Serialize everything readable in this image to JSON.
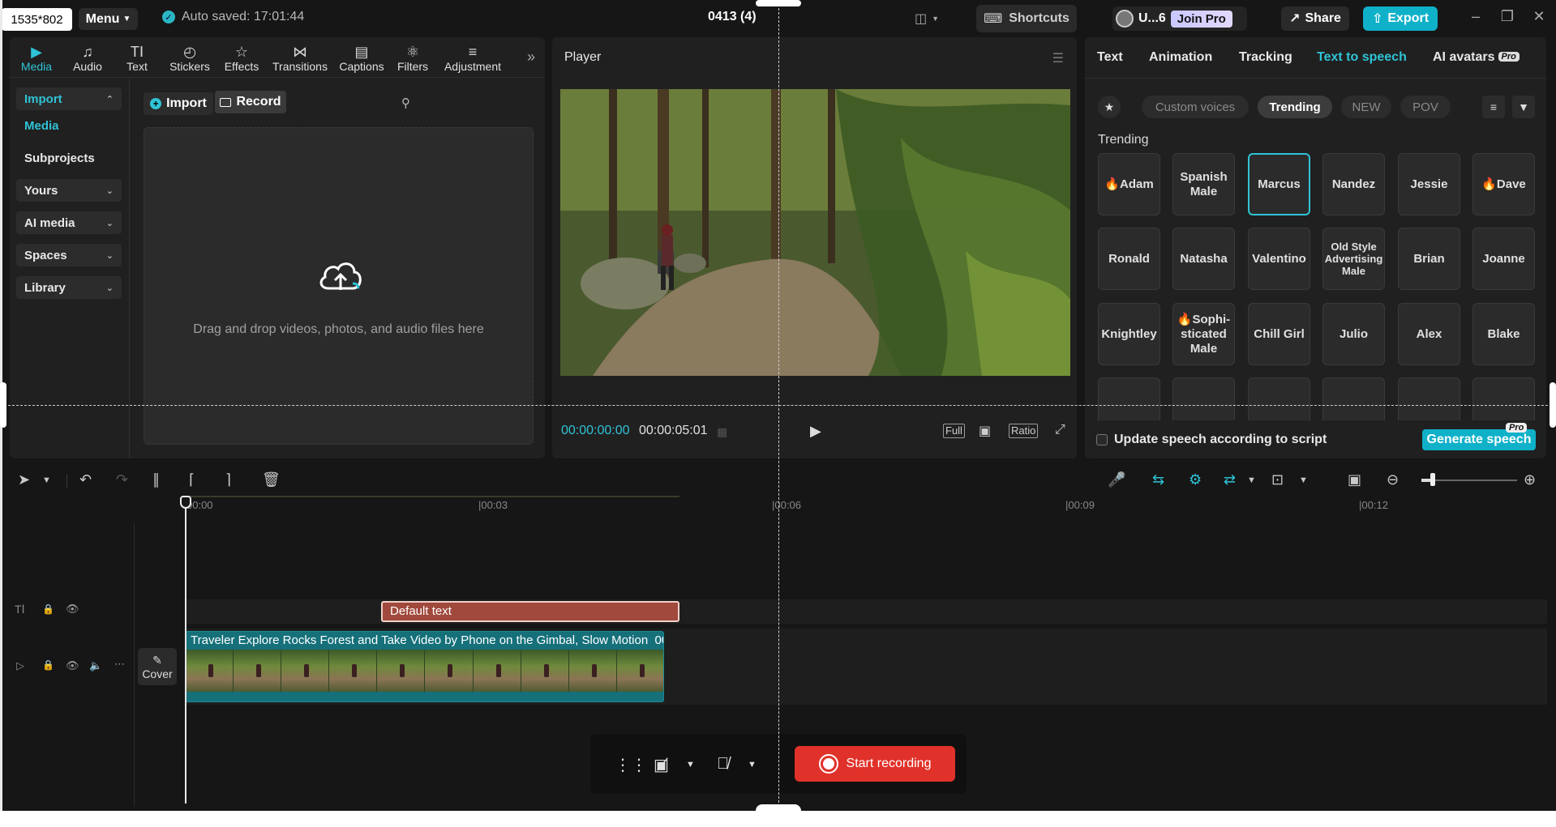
{
  "overlay": {
    "dimensions_badge": "1535*802"
  },
  "topbar": {
    "menu_label": "Menu",
    "autosave_text": "Auto saved: 17:01:44",
    "project_title": "0413 (4)",
    "shortcuts_label": "Shortcuts",
    "user_name": "U...6",
    "join_pro_label": "Join Pro",
    "share_label": "Share",
    "export_label": "Export"
  },
  "tools": {
    "tabs": [
      {
        "label": "Media",
        "icon": "media-icon"
      },
      {
        "label": "Audio",
        "icon": "audio-icon"
      },
      {
        "label": "Text",
        "icon": "text-icon"
      },
      {
        "label": "Stickers",
        "icon": "stickers-icon"
      },
      {
        "label": "Effects",
        "icon": "effects-icon"
      },
      {
        "label": "Transitions",
        "icon": "transitions-icon"
      },
      {
        "label": "Captions",
        "icon": "captions-icon"
      },
      {
        "label": "Filters",
        "icon": "filters-icon"
      },
      {
        "label": "Adjustment",
        "icon": "adjustment-icon"
      }
    ],
    "active_tab": "Media"
  },
  "sidebar": {
    "items": [
      {
        "label": "Import",
        "type": "dropdown",
        "state": "expanded"
      },
      {
        "label": "Media",
        "type": "item",
        "state": "selected"
      },
      {
        "label": "Subprojects",
        "type": "item"
      },
      {
        "label": "Yours",
        "type": "dropdown"
      },
      {
        "label": "AI media",
        "type": "dropdown"
      },
      {
        "label": "Spaces",
        "type": "dropdown"
      },
      {
        "label": "Library",
        "type": "dropdown"
      }
    ]
  },
  "media": {
    "import_label": "Import",
    "record_label": "Record",
    "dropzone_text": "Drag and drop videos, photos, and audio files here"
  },
  "player": {
    "title": "Player",
    "current_time": "00:00:00:00",
    "total_time": "00:00:05:01",
    "full_label": "Full",
    "ratio_label": "Ratio"
  },
  "right_panel": {
    "tabs": [
      "Text",
      "Animation",
      "Tracking",
      "Text to speech",
      "AI avatars"
    ],
    "active_tab": "Text to speech",
    "pro_badge": "Pro",
    "filter_chips": [
      "Custom voices",
      "Trending",
      "NEW",
      "POV"
    ],
    "active_chip": "Trending",
    "section_title": "Trending",
    "voices": [
      {
        "name": "Adam",
        "hot": true
      },
      {
        "name": "Spanish Male"
      },
      {
        "name": "Marcus",
        "selected": true
      },
      {
        "name": "Nandez"
      },
      {
        "name": "Jessie"
      },
      {
        "name": "Dave",
        "hot": true
      },
      {
        "name": "Ronald"
      },
      {
        "name": "Natasha"
      },
      {
        "name": "Valentino"
      },
      {
        "name": "Old Style Advertising Male"
      },
      {
        "name": "Brian"
      },
      {
        "name": "Joanne"
      },
      {
        "name": "Knightley"
      },
      {
        "name": "Sophi-sticated Male",
        "hot": true
      },
      {
        "name": "Chill Girl"
      },
      {
        "name": "Julio"
      },
      {
        "name": "Alex"
      },
      {
        "name": "Blake"
      }
    ],
    "update_speech_label": "Update speech according to script",
    "generate_label": "Generate speech",
    "generate_pro_badge": "Pro"
  },
  "timeline": {
    "ruler_ticks": [
      "00:00",
      "00:03",
      "00:06",
      "00:09",
      "00:12"
    ],
    "text_clip_label": "Default text",
    "video_clip_title": "Traveler Explore Rocks Forest and Take Video by Phone on the Gimbal, Slow Motion",
    "video_clip_duration": "00:0",
    "cover_label": "Cover"
  },
  "recording": {
    "start_label": "Start recording"
  },
  "colors": {
    "accent": "#2fc3d6",
    "export": "#0fb1c9",
    "record": "#e0322a",
    "text_clip": "#a0493c",
    "video_clip": "#15707a"
  }
}
